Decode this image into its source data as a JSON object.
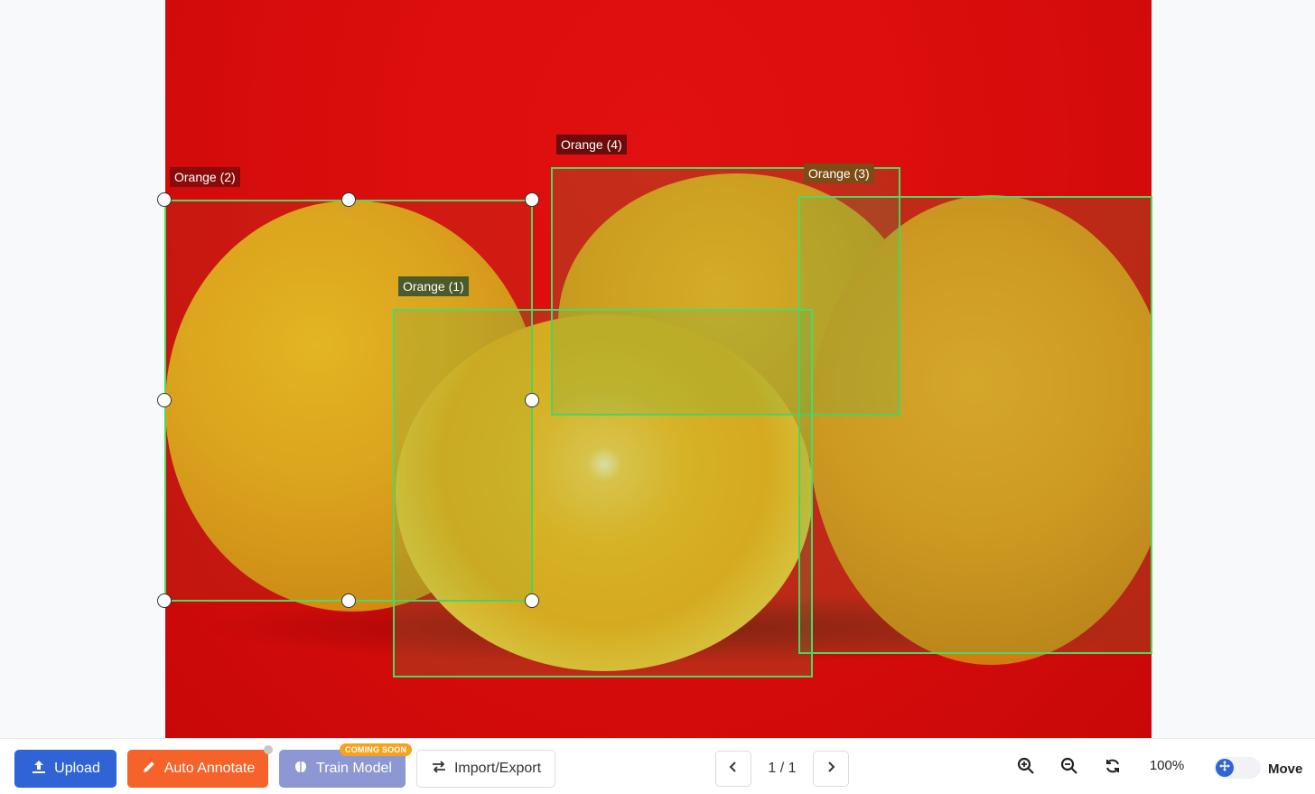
{
  "annotations": [
    {
      "label": "Orange (1)",
      "label_bg": "#4b5a2a"
    },
    {
      "label": "Orange (2)",
      "label_bg": "#8a0b0b"
    },
    {
      "label": "Orange (3)",
      "label_bg": "#7d4b14"
    },
    {
      "label": "Orange (4)",
      "label_bg": "#6b0b0b"
    }
  ],
  "toolbar": {
    "upload_label": "Upload",
    "auto_annotate_label": "Auto Annotate",
    "train_model_label": "Train Model",
    "coming_soon_badge": "COMING SOON",
    "import_export_label": "Import/Export",
    "page_indicator": "1 / 1",
    "zoom_level": "100%",
    "mode_label": "Move"
  },
  "colors": {
    "bbox_border": "#4cd964",
    "upload_bg": "#2f63d6",
    "auto_annotate_bg": "#f5622a",
    "train_model_bg": "#8c97d4",
    "badge_bg": "#f7a21b"
  },
  "icons": {
    "upload": "upload-icon",
    "auto_annotate": "pencil-icon",
    "train_model": "brain-icon",
    "import_export": "swap-arrows-icon",
    "prev": "chevron-left-icon",
    "next": "chevron-right-icon",
    "zoom_in": "zoom-in-icon",
    "zoom_out": "zoom-out-icon",
    "reset": "refresh-icon",
    "move": "move-icon"
  }
}
